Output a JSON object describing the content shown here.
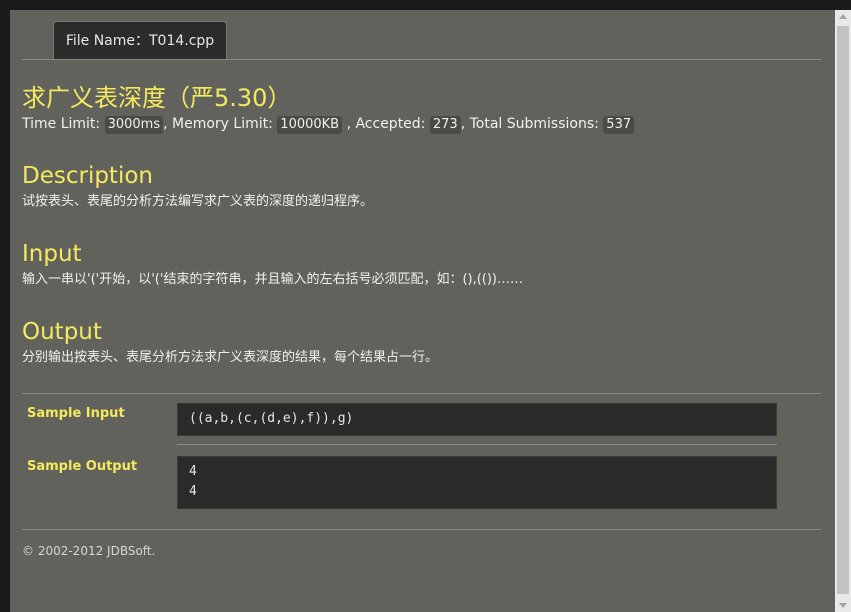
{
  "tab": {
    "label": "File Name：T014.cpp"
  },
  "problem": {
    "title": "求广义表深度（严5.30）",
    "limits": {
      "time_label": "Time Limit:",
      "time_value": "3000ms",
      "memory_label": ", Memory Limit:",
      "memory_value": "10000KB",
      "accepted_label": ", Accepted:",
      "accepted_value": "273",
      "submissions_label": ", Total Submissions:",
      "submissions_value": "537"
    }
  },
  "sections": {
    "description": {
      "heading": "Description",
      "text": "试按表头、表尾的分析方法编写求广义表的深度的递归程序。"
    },
    "input": {
      "heading": "Input",
      "text": "输入一串以'('开始，以'('结束的字符串，并且输入的左右括号必须匹配，如：(),(())……"
    },
    "output": {
      "heading": "Output",
      "text": "分别输出按表头、表尾分析方法求广义表深度的结果，每个结果占一行。"
    }
  },
  "samples": {
    "input_label": "Sample Input",
    "input_value": "((a,b,(c,(d,e),f)),g)",
    "output_label": "Sample Output",
    "output_value": "4\n4"
  },
  "footer": {
    "text": "© 2002-2012  JDBSoft."
  },
  "colors": {
    "background": "#62625c",
    "heading": "#f5ea5e",
    "code_bg": "#2a2a2a",
    "text": "#f0f0f0"
  }
}
